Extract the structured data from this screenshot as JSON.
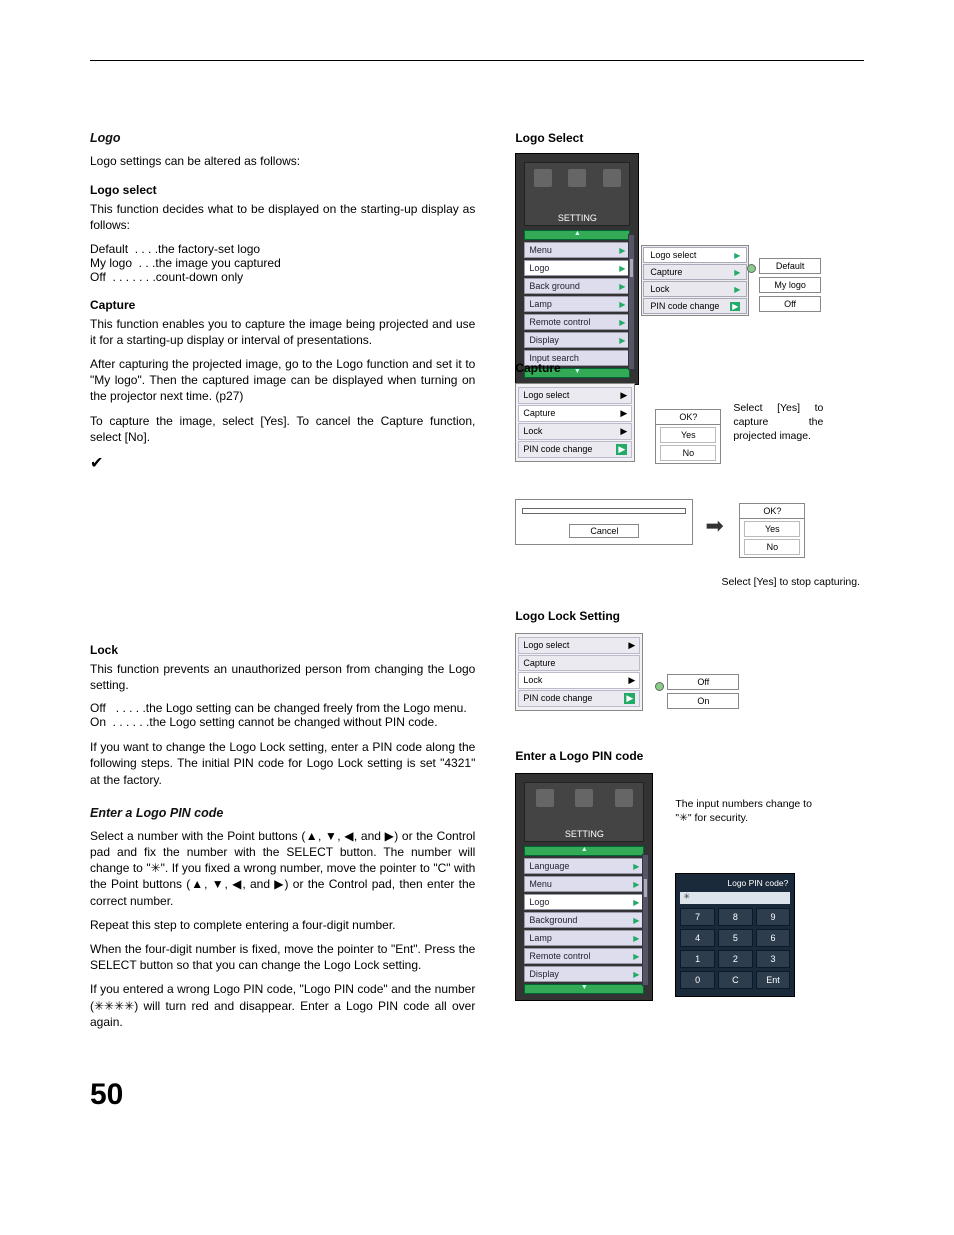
{
  "page_number": "50",
  "left": {
    "logo": {
      "heading": "Logo",
      "intro": "Logo settings can be altered as follows:",
      "logo_select": {
        "heading": "Logo select",
        "desc": "This function decides what to be displayed on the starting-up display as follows:",
        "rows": [
          {
            "term": "Default  . . . .",
            "def": "the factory-set logo"
          },
          {
            "term": "My logo  . . .",
            "def": "the image you captured"
          },
          {
            "term": "Off  . . . . . . .",
            "def": "count-down only"
          }
        ]
      },
      "capture": {
        "heading": "Capture",
        "p1": "This function enables you to capture the image being projected and use it for a starting-up display or interval of presentations.",
        "p2": "After capturing the projected image, go to the Logo function and set it to \"My logo\". Then the captured image can be displayed when turning on the projector next time. (p27)",
        "p3": "To capture the image, select [Yes]. To cancel the Capture function, select [No].",
        "check": "✔"
      },
      "lock": {
        "heading": "Lock",
        "desc": "This function prevents an unauthorized person from changing the Logo setting.",
        "rows": [
          {
            "term": "Off   . . . . .",
            "def": "the Logo setting can be changed freely from the Logo menu."
          },
          {
            "term": "On  . . . . . .",
            "def": "the Logo setting cannot be changed without PIN code."
          }
        ],
        "p2": "If you want to change the Logo Lock setting, enter a PIN code along the following steps. The initial PIN code for Logo Lock setting is set \"4321\" at the factory."
      },
      "pin": {
        "heading": "Enter a Logo PIN code",
        "p1": "Select a number with the Point buttons (▲, ▼, ◀, and ▶) or the Control pad and fix the number with the SELECT button. The number will change to \"✳\". If you fixed a wrong number, move the pointer to \"C\" with the Point buttons (▲, ▼, ◀, and ▶) or the Control pad, then enter the correct number.",
        "p2": "Repeat this step to complete entering a four-digit number.",
        "p3": "When the four-digit number is fixed, move the pointer to \"Ent\". Press the SELECT button so that you can change the Logo Lock setting.",
        "p4": "If you entered a wrong Logo PIN code, \"Logo PIN code\" and the number (✳✳✳✳) will turn red and disappear. Enter a Logo PIN code all over again."
      }
    }
  },
  "right": {
    "logo_select": {
      "heading": "Logo Select",
      "setting_label": "SETTING",
      "menu_items": [
        "Menu",
        "Logo",
        "Back ground",
        "Lamp",
        "Remote control",
        "Display",
        "Input search"
      ],
      "submenu": [
        "Logo select",
        "Capture",
        "Lock",
        "PIN code change"
      ],
      "options": [
        "Default",
        "My logo",
        "Off"
      ]
    },
    "capture": {
      "heading": "Capture",
      "submenu": [
        "Logo select",
        "Capture",
        "Lock",
        "PIN code change"
      ],
      "ok_label": "OK?",
      "yes": "Yes",
      "no": "No",
      "note1": "Select [Yes] to capture the projected image.",
      "cancel": "Cancel",
      "note2": "Select [Yes] to stop capturing."
    },
    "lockset": {
      "heading": "Logo Lock Setting",
      "submenu": [
        "Logo select",
        "Capture",
        "Lock",
        "PIN code change"
      ],
      "options": [
        "Off",
        "On"
      ]
    },
    "pin": {
      "heading": "Enter a Logo PIN code",
      "setting_label": "SETTING",
      "menu_items": [
        "Language",
        "Menu",
        "Logo",
        "Background",
        "Lamp",
        "Remote control",
        "Display"
      ],
      "note": "The input numbers change to \"✳\" for security.",
      "kp_title": "Logo PIN code?",
      "disp": "✳",
      "keys": [
        [
          "7",
          "8",
          "9"
        ],
        [
          "4",
          "5",
          "6"
        ],
        [
          "1",
          "2",
          "3"
        ],
        [
          "0",
          "C",
          "Ent"
        ]
      ]
    }
  }
}
